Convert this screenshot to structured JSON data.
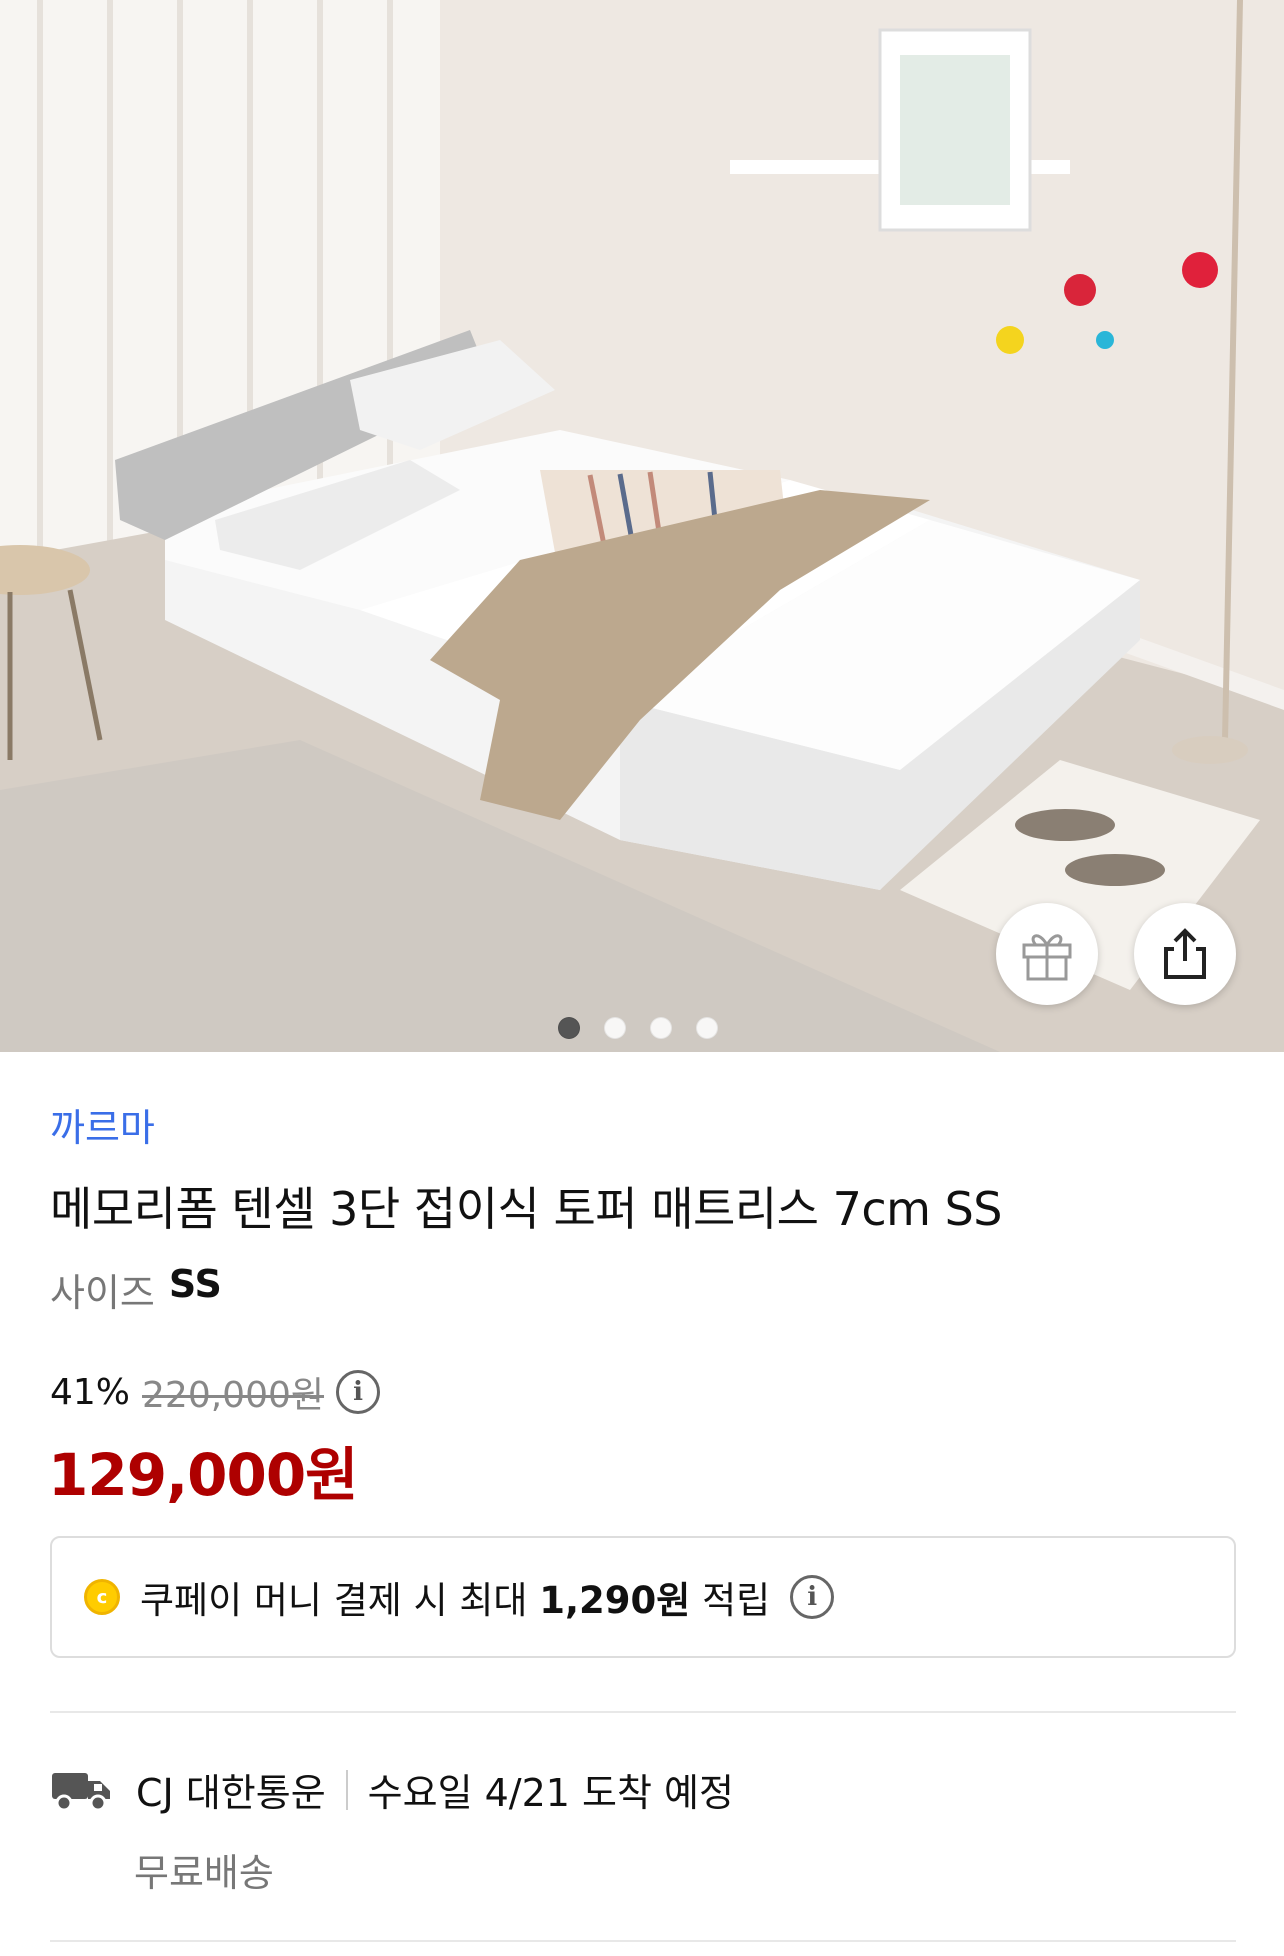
{
  "gallery": {
    "image_alt": "",
    "page_count": 4,
    "active_index": 0
  },
  "product": {
    "brand": "까르마",
    "title": "메모리폼 텐셀 3단 접이식 토퍼 매트리스 7cm SS",
    "option_label": "사이즈",
    "option_value": "SS",
    "discount_rate": "41%",
    "original_price": "220,000원",
    "sale_price": "129,000원"
  },
  "coupay": {
    "text_before": "쿠페이 머니 결제 시 최대",
    "amount": "1,290원",
    "text_after": "적립",
    "coin_letter": "c"
  },
  "delivery": {
    "carrier": "CJ 대한통운",
    "eta": "수요일 4/21 도착 예정",
    "shipping_fee": "무료배송"
  },
  "colors": {
    "brand_link": "#3a6ee8",
    "sale_price": "#ae0000",
    "coin": "#ffcc00"
  },
  "icons": {
    "gift": "gift-icon",
    "share": "share-icon",
    "info": "info-icon",
    "truck": "truck-icon"
  }
}
